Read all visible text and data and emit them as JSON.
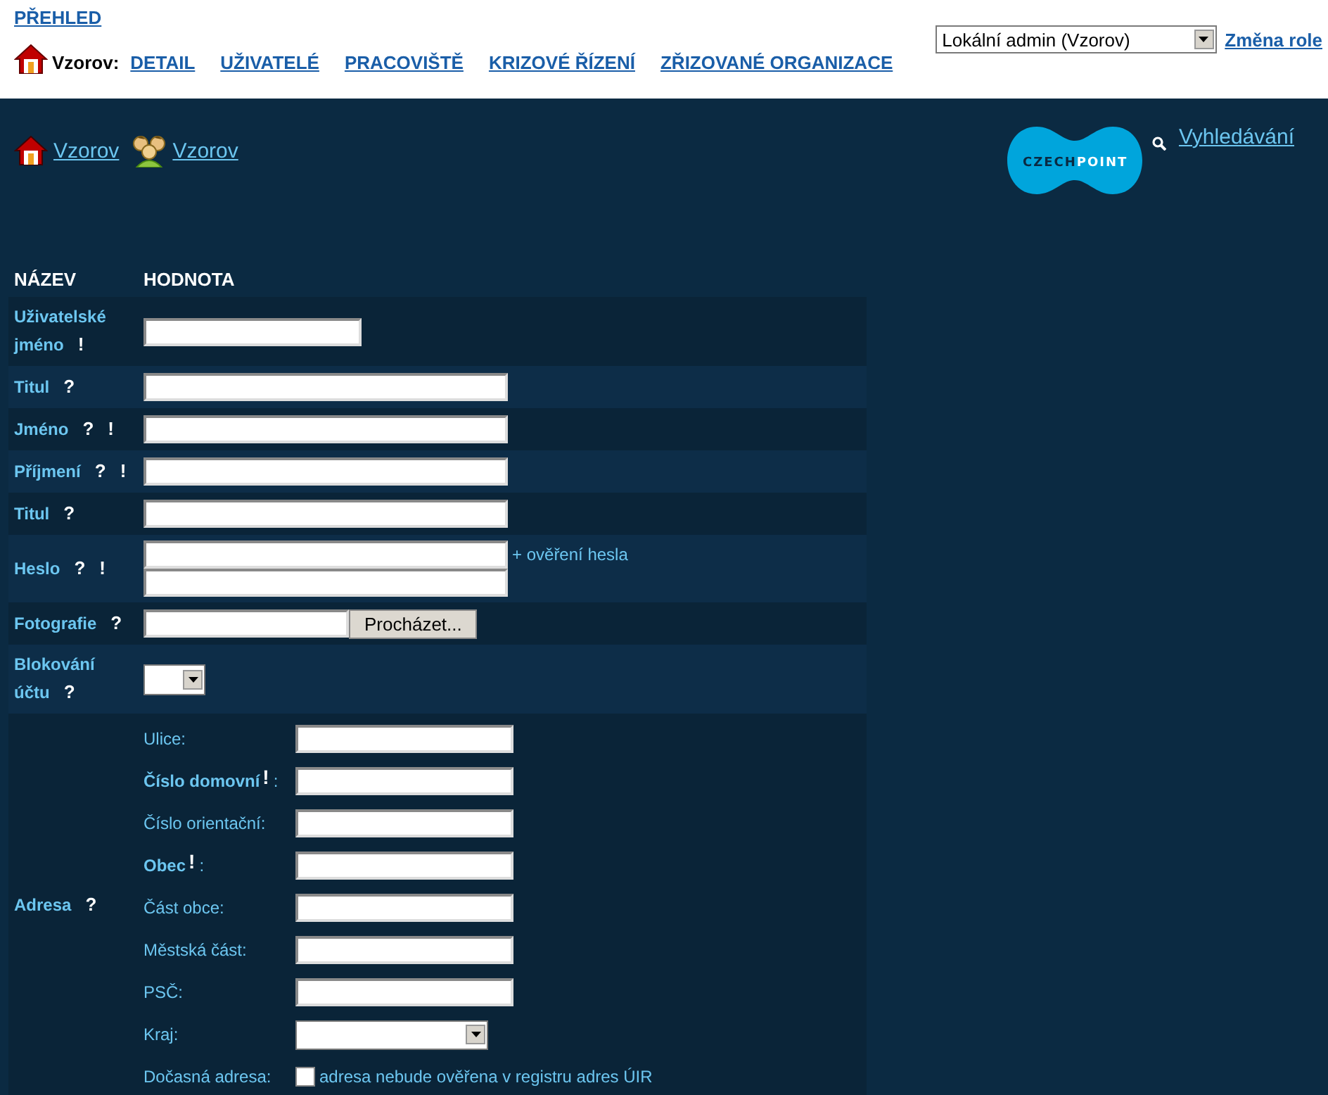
{
  "top_link": "PŘEHLED",
  "org_label": "Vzorov:",
  "tabs": [
    {
      "label": "DETAIL"
    },
    {
      "label": "UŽIVATELÉ"
    },
    {
      "label": "PRACOVIŠTĚ"
    },
    {
      "label": "KRIZOVÉ ŘÍZENÍ"
    },
    {
      "label": "ZŘIZOVANÉ ORGANIZACE"
    }
  ],
  "role_select": {
    "value": "Lokální admin (Vzorov)"
  },
  "role_button": "Změna role",
  "breadcrumb": [
    {
      "kind": "house",
      "label": "Vzorov"
    },
    {
      "kind": "users",
      "label": "Vzorov"
    }
  ],
  "logo": {
    "part_1": "CZECH",
    "part_2": "POINT"
  },
  "search_link": "Vyhledávání",
  "table": {
    "columns": [
      "NÁZEV",
      "HODNOTA"
    ],
    "rows": [
      {
        "label": "Uživatelské jméno",
        "marks": [
          "!"
        ],
        "kind": "short"
      },
      {
        "label": "Titul",
        "marks": [
          "?"
        ],
        "kind": "text"
      },
      {
        "label": "Jméno",
        "marks": [
          "?",
          "!"
        ],
        "kind": "text"
      },
      {
        "label": "Příjmení",
        "marks": [
          "?",
          "!"
        ],
        "kind": "text"
      },
      {
        "label": "Titul",
        "marks": [
          "?"
        ],
        "kind": "text"
      },
      {
        "label": "Heslo",
        "marks": [
          "?",
          "!"
        ],
        "kind": "password",
        "note": "+ ověření hesla"
      },
      {
        "label": "Fotografie",
        "marks": [
          "?"
        ],
        "kind": "file",
        "button": "Procházet..."
      },
      {
        "label": "Blokování účtu",
        "marks": [
          "?"
        ],
        "kind": "select"
      },
      {
        "label": "Adresa",
        "marks": [
          "?"
        ],
        "kind": "address",
        "fields": [
          {
            "label": "Ulice:",
            "kind": "text",
            "bold": false
          },
          {
            "label": "Číslo domovní",
            "mark": "!",
            "suffix": ":",
            "kind": "text",
            "bold": true
          },
          {
            "label": "Číslo orientační:",
            "kind": "text",
            "bold": false
          },
          {
            "label": "Obec",
            "mark": "!",
            "suffix": ":",
            "kind": "text",
            "bold": true
          },
          {
            "label": "Část obce:",
            "kind": "text",
            "bold": false
          },
          {
            "label": "Městská část:",
            "kind": "text",
            "bold": false
          },
          {
            "label": "PSČ:",
            "kind": "text",
            "bold": false
          },
          {
            "label": "Kraj:",
            "kind": "select",
            "bold": false
          },
          {
            "label": "Dočasná adresa:",
            "kind": "checkbox",
            "bold": false,
            "checked": false,
            "text": "adresa nebude ověřena v registru adres ÚIR"
          }
        ]
      }
    ]
  }
}
